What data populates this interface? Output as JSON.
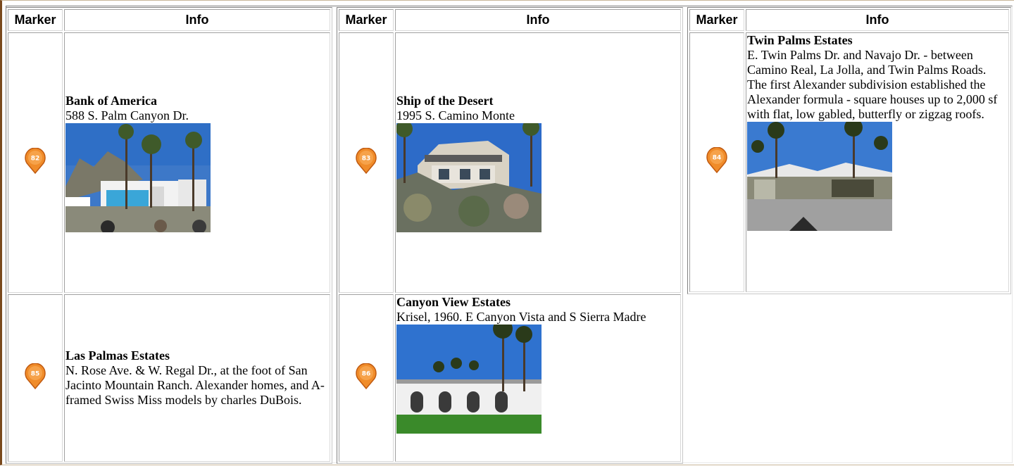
{
  "headers": {
    "marker": "Marker",
    "info": "Info"
  },
  "colors": {
    "marker_fill": "#f08c2a",
    "marker_stroke": "#c05a10",
    "frame": "#7a4a1e"
  },
  "entries": [
    {
      "marker_number": "82",
      "title": "Bank of America",
      "lines": [
        "588 S. Palm Canyon Dr."
      ],
      "photo": "bank-building-with-palms"
    },
    {
      "marker_number": "83",
      "title": "Ship of the Desert",
      "lines": [
        "1995 S. Camino Monte"
      ],
      "photo": "hillside-modern-house"
    },
    {
      "marker_number": "84",
      "title": "Twin Palms Estates",
      "lines": [
        "E. Twin Palms Dr. and Navajo Dr. - between Camino Real, La Jolla, and Twin Palms Roads.",
        "The first Alexander subdivision established the Alexander formula - square houses up to 2,000 sf with flat, low gabled, butterfly or zigzag roofs."
      ],
      "photo": "butterfly-roof-house"
    },
    {
      "marker_number": "85",
      "title": "Las Palmas Estates",
      "lines": [
        "N. Rose Ave. & W. Regal Dr., at the foot of San Jacinto Mountain Ranch. Alexander homes, and A-framed Swiss Miss models by charles DuBois."
      ],
      "photo": ""
    },
    {
      "marker_number": "86",
      "title": "Canyon View Estates",
      "lines": [
        "Krisel, 1960. E Canyon Vista and S Sierra Madre"
      ],
      "photo": "white-condos-with-palms"
    }
  ]
}
